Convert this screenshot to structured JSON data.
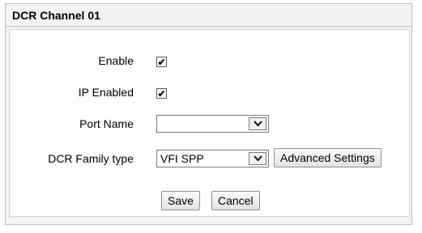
{
  "panel": {
    "title": "DCR Channel 01"
  },
  "form": {
    "enable": {
      "label": "Enable",
      "checked": true
    },
    "ip_enabled": {
      "label": "IP Enabled",
      "checked": true
    },
    "port_name": {
      "label": "Port Name",
      "value": ""
    },
    "dcr_family_type": {
      "label": "DCR Family type",
      "value": "VFI SPP"
    }
  },
  "buttons": {
    "advanced_settings": "Advanced Settings",
    "save": "Save",
    "cancel": "Cancel"
  },
  "icons": {
    "checkmark": "checkmark-icon",
    "dropdown": "chevron-down-icon"
  }
}
